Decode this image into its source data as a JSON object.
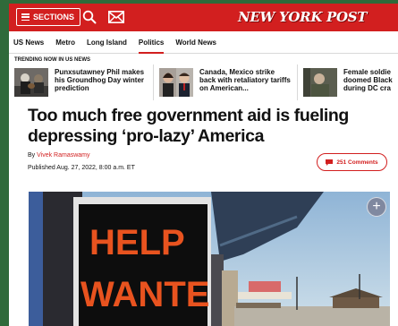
{
  "header": {
    "sections_label": "SECTIONS",
    "logo_text": "NEW YORK POST",
    "brand_color": "#d21f1f"
  },
  "nav": {
    "items": [
      {
        "label": "US News",
        "active": false
      },
      {
        "label": "Metro",
        "active": false
      },
      {
        "label": "Long Island",
        "active": false
      },
      {
        "label": "Politics",
        "active": true
      },
      {
        "label": "World News",
        "active": false
      }
    ]
  },
  "trending": {
    "label": "TRENDING NOW IN US NEWS",
    "items": [
      {
        "title": "Punxsutawney Phil makes his Groundhog Day winter prediction"
      },
      {
        "title": "Canada, Mexico strike back with retaliatory tariffs on American..."
      },
      {
        "title": "Female soldie doomed Black during DC cra"
      }
    ]
  },
  "article": {
    "headline": "Too much free government aid is fueling depressing ‘pro-lazy’ America",
    "by_prefix": "By",
    "author": "Vivek Ramaswamy",
    "published": "Published Aug. 27, 2022, 8:00 a.m. ET",
    "comments_label": "251 Comments",
    "hero": {
      "sign_line1": "HELP",
      "sign_line2": "WANTED",
      "expand_label": "+"
    }
  },
  "icons": {
    "search": "search-icon",
    "mail": "mail-icon",
    "menu": "hamburger-icon",
    "comment": "comment-icon",
    "expand": "plus-icon"
  }
}
